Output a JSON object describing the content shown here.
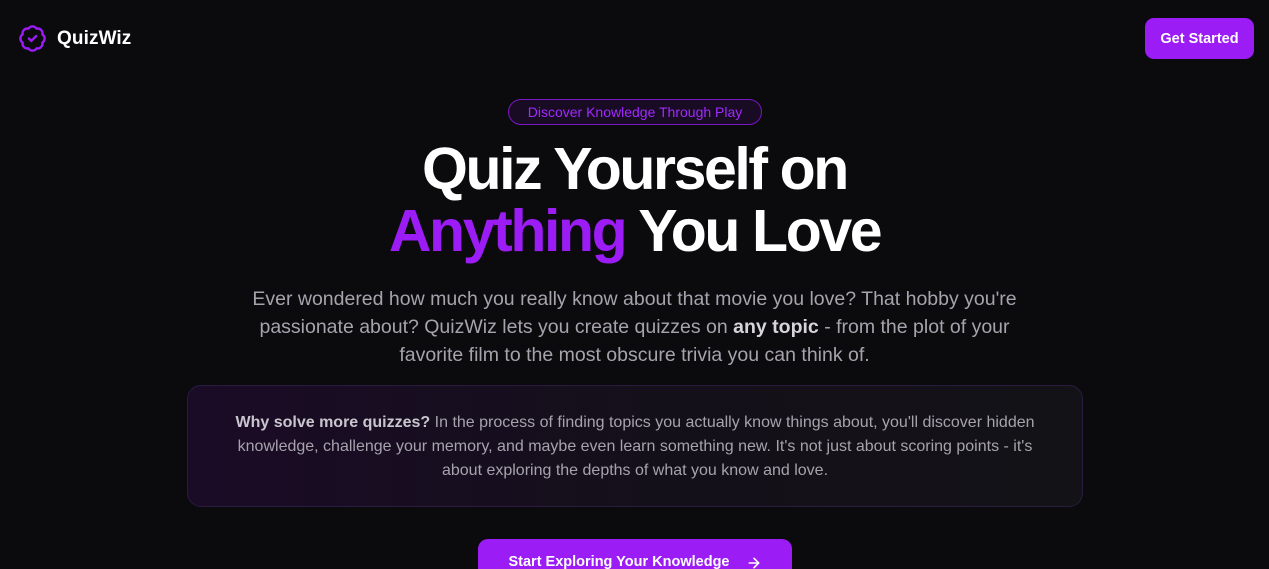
{
  "header": {
    "brand_name": "QuizWiz",
    "logo_icon": "badge-check-icon",
    "cta_label": "Get Started"
  },
  "hero": {
    "badge": "Discover Knowledge Through Play",
    "headline_line1": "Quiz Yourself on",
    "headline_accent": "Anything",
    "headline_rest": "You Love",
    "subtitle_part1": "Ever wondered how much you really know about that movie you love? That hobby you're passionate about? QuizWiz lets you create quizzes on",
    "subtitle_emphasis": "any topic",
    "subtitle_part2": "- from the plot of your favorite film to the most obscure trivia you can think of."
  },
  "info": {
    "lead": "Why solve more quizzes?",
    "body": "In the process of finding topics you actually know things about, you'll discover hidden knowledge, challenge your memory, and maybe even learn something new. It's not just about scoring points - it's about exploring the depths of what you know and love."
  },
  "cta": {
    "label": "Start Exploring Your Knowledge",
    "icon": "arrow-right-icon"
  },
  "colors": {
    "background": "#0b0a0d",
    "accent": "#9b1cf5",
    "badge_text": "#a12aff",
    "muted_text": "#a6a3ad"
  }
}
